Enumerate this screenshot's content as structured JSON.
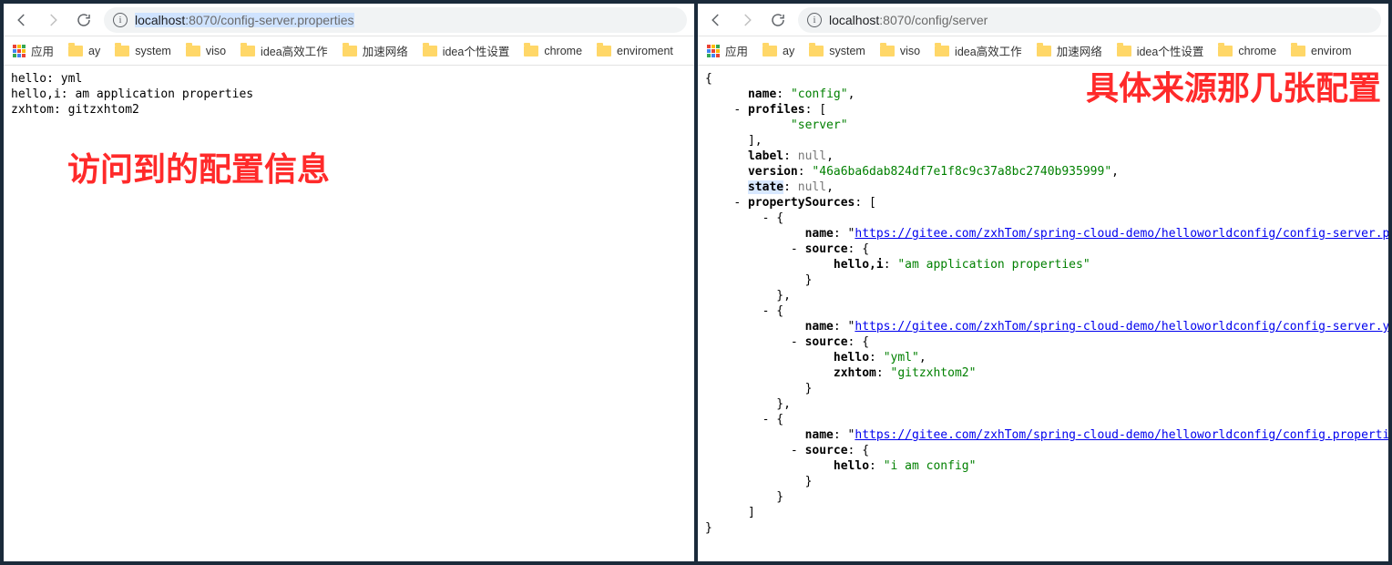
{
  "left": {
    "url_host": "localhost",
    "url_port": ":8070",
    "url_path": "/config-server.properties",
    "url_selected": true,
    "body_lines": [
      "hello: yml",
      "hello,i: am application properties",
      "zxhtom: gitzxhtom2"
    ],
    "annotation": "访问到的配置信息"
  },
  "right": {
    "url_host": "localhost",
    "url_port": ":8070",
    "url_path": "/config/server",
    "url_selected": false,
    "annotation": "具体来源那几张配置",
    "json": {
      "name": "config",
      "profiles": [
        "server"
      ],
      "label": null,
      "version": "46a6ba6dab824df7e1f8c9c37a8bc2740b935999",
      "state": null,
      "propertySources": [
        {
          "name": "https://gitee.com/zxhTom/spring-cloud-demo/helloworldconfig/config-server.properties",
          "source": {
            "hello,i": "am application properties"
          }
        },
        {
          "name": "https://gitee.com/zxhTom/spring-cloud-demo/helloworldconfig/config-server.yml",
          "source": {
            "hello": "yml",
            "zxhtom": "gitzxhtom2"
          }
        },
        {
          "name": "https://gitee.com/zxhTom/spring-cloud-demo/helloworldconfig/config.properties",
          "source": {
            "hello": "i am config"
          }
        }
      ]
    },
    "highlight_keys": [
      "state"
    ]
  },
  "bookmarks": {
    "apps_label": "应用",
    "items": [
      "ay",
      "system",
      "viso",
      "idea高效工作",
      "加速网络",
      "idea个性设置",
      "chrome",
      "enviroment"
    ],
    "items_right_clipped": [
      "ay",
      "system",
      "viso",
      "idea高效工作",
      "加速网络",
      "idea个性设置",
      "chrome",
      "envirom"
    ]
  }
}
